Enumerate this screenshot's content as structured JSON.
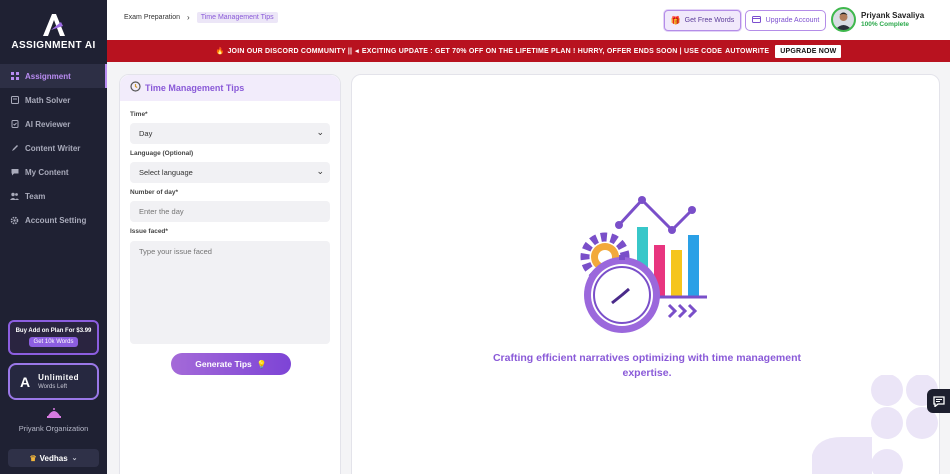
{
  "brand": {
    "logo_text": "ASSIGNMENT AI"
  },
  "sidebar": {
    "items": [
      {
        "label": "Assignment",
        "icon": "grid-icon",
        "active": true
      },
      {
        "label": "Math Solver",
        "icon": "calculator-icon",
        "active": false
      },
      {
        "label": "AI Reviewer",
        "icon": "document-check-icon",
        "active": false
      },
      {
        "label": "Content Writer",
        "icon": "pen-icon",
        "active": false
      },
      {
        "label": "My Content",
        "icon": "chat-icon",
        "active": false
      },
      {
        "label": "Team",
        "icon": "team-icon",
        "active": false
      },
      {
        "label": "Account Setting",
        "icon": "gear-icon",
        "active": false
      }
    ],
    "addon": {
      "title": "Buy Add on Plan For $3.99",
      "button": "Get 10k Words"
    },
    "plan": {
      "logo": "A",
      "title": "Unlimited",
      "subtitle": "Words Left"
    },
    "organization": "Priyank Organization",
    "workspace": "Vedhas"
  },
  "header": {
    "breadcrumbs": [
      "Exam Preparation",
      "Time Management Tips"
    ],
    "free_words_label": "Get Free Words",
    "upgrade_label": "Upgrade Account",
    "user": {
      "name": "Priyank Savaliya",
      "progress": "100% Complete"
    }
  },
  "banner": {
    "text_a": "JOIN OUR DISCORD COMMUNITY ||",
    "text_b": "EXCITING UPDATE : GET 70% OFF ON THE LIFETIME PLAN ! HURRY, OFFER ENDS SOON | USE CODE",
    "code": "AUTOWRITE",
    "button": "UPGRADE NOW"
  },
  "form": {
    "title": "Time Management Tips",
    "time_label": "Time*",
    "time_value": "Day",
    "language_label": "Language (Optional)",
    "language_value": "Select language",
    "days_label": "Number of day*",
    "days_placeholder": "Enter the day",
    "issue_label": "Issue faced*",
    "issue_placeholder": "Type your issue faced",
    "generate_label": "Generate Tips"
  },
  "output": {
    "message": "Crafting efficient narratives optimizing with time management expertise."
  },
  "colors": {
    "accent": "#8a5ad8",
    "sidebar_bg": "#1f2133",
    "banner_bg": "#b8121f",
    "success": "#2aa84a"
  }
}
